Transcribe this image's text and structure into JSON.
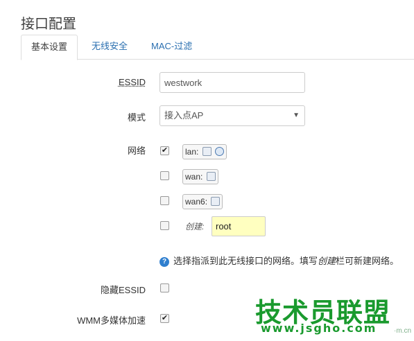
{
  "page_title": "接口配置",
  "tabs": [
    {
      "label": "基本设置",
      "active": true
    },
    {
      "label": "无线安全",
      "active": false
    },
    {
      "label": "MAC-过滤",
      "active": false
    }
  ],
  "form": {
    "essid": {
      "label": "ESSID",
      "value": "westwork"
    },
    "mode": {
      "label": "模式",
      "selected": "接入点AP"
    },
    "network": {
      "label": "网络",
      "options": [
        {
          "name": "lan:",
          "checked": true,
          "icons": [
            "ethernet-icon",
            "wifi-icon"
          ]
        },
        {
          "name": "wan:",
          "checked": false,
          "icons": [
            "ethernet-icon"
          ]
        },
        {
          "name": "wan6:",
          "checked": false,
          "icons": [
            "ethernet-icon"
          ]
        }
      ],
      "create": {
        "label": "创建:",
        "value": "root",
        "checked": false
      }
    },
    "hint": {
      "prefix": "选择指派到此无线接口的网络。填写",
      "emphasis": "创建",
      "suffix": "栏可新建网络。"
    },
    "hide_essid": {
      "label": "隐藏ESSID",
      "checked": false
    },
    "wmm": {
      "label": "WMM多媒体加速",
      "checked": true
    }
  },
  "watermark": {
    "text": "技术员联盟",
    "url": "www.jsgho.com",
    "small": "·m.cn"
  },
  "colors": {
    "link_tab": "#2a6fb0",
    "create_input_bg": "#ffffc0",
    "watermark_green": "#1a9a2e",
    "hint_icon": "#2f7fcf"
  }
}
